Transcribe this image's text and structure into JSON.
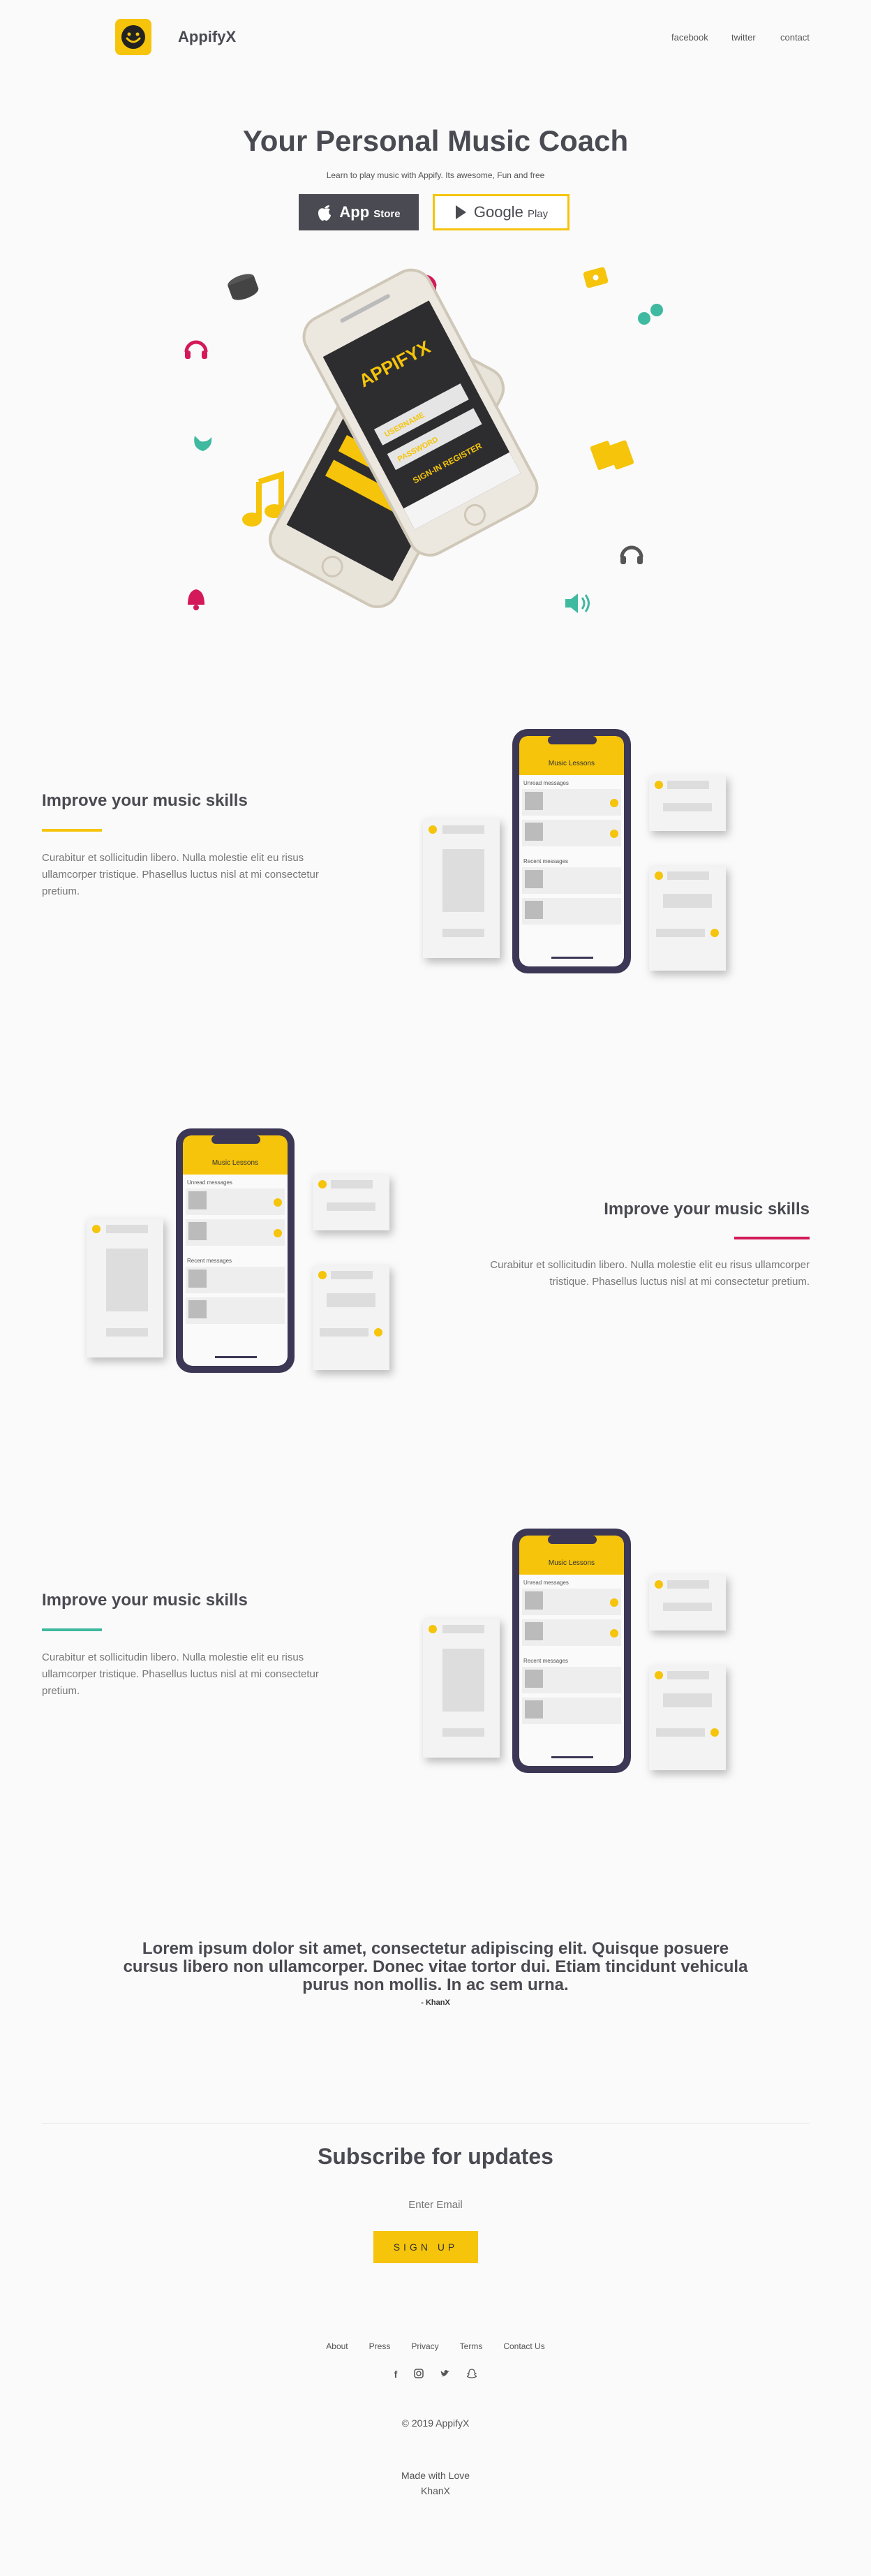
{
  "header": {
    "brand": "AppifyX",
    "nav": [
      "facebook",
      "twitter",
      "contact"
    ]
  },
  "hero": {
    "title": "Your Personal Music Coach",
    "subtitle": "Learn to play music with Appify. Its awesome, Fun and free",
    "appstore": {
      "main": "App",
      "small": "Store"
    },
    "google": {
      "main": "Google",
      "small": "Play"
    },
    "phone_logo": "APPIFYX",
    "phone_username": "USERNAME",
    "phone_password": "PASSWORD",
    "phone_actions": "SIGN-IN  REGISTER"
  },
  "mockup": {
    "header": "Music Lessons",
    "unread": "Unread messages",
    "recent": "Recent messages"
  },
  "features": [
    {
      "title": "Improve your music skills",
      "text": " Curabitur et sollicitudin libero. Nulla molestie elit eu risus ullamcorper tristique. Phasellus luctus nisl at mi consectetur pretium.",
      "accent": "#f5c40b"
    },
    {
      "title": "Improve your music skills",
      "text": "Curabitur et sollicitudin libero. Nulla molestie elit eu risus ullamcorper tristique. Phasellus luctus nisl at mi consectetur pretium.",
      "accent": "#d3195a"
    },
    {
      "title": "Improve your music skills",
      "text": " Curabitur et sollicitudin libero. Nulla molestie elit eu risus ullamcorper tristique. Phasellus luctus nisl at mi consectetur pretium.",
      "accent": "#3fb99f"
    }
  ],
  "quote": {
    "text": "Lorem ipsum dolor sit amet, consectetur adipiscing elit. Quisque posuere cursus libero non ullamcorper. Donec vitae tortor dui. Etiam tincidunt vehicula purus non mollis. In ac sem urna.",
    "author": "- KhanX"
  },
  "subscribe": {
    "title": "Subscribe for updates",
    "placeholder": "Enter Email",
    "button": "SIGN UP"
  },
  "footer": {
    "links": [
      "About",
      "Press",
      "Privacy",
      "Terms",
      "Contact Us"
    ],
    "social": [
      "facebook-icon",
      "instagram-icon",
      "twitter-icon",
      "snapchat-icon"
    ],
    "copyright": "© 2019 AppifyX",
    "made_with": "Made with Love",
    "author": "KhanX"
  },
  "colors": {
    "brand": "#f5c40b",
    "dark": "#4a4a52",
    "pink": "#d3195a",
    "green": "#3fb99f"
  }
}
